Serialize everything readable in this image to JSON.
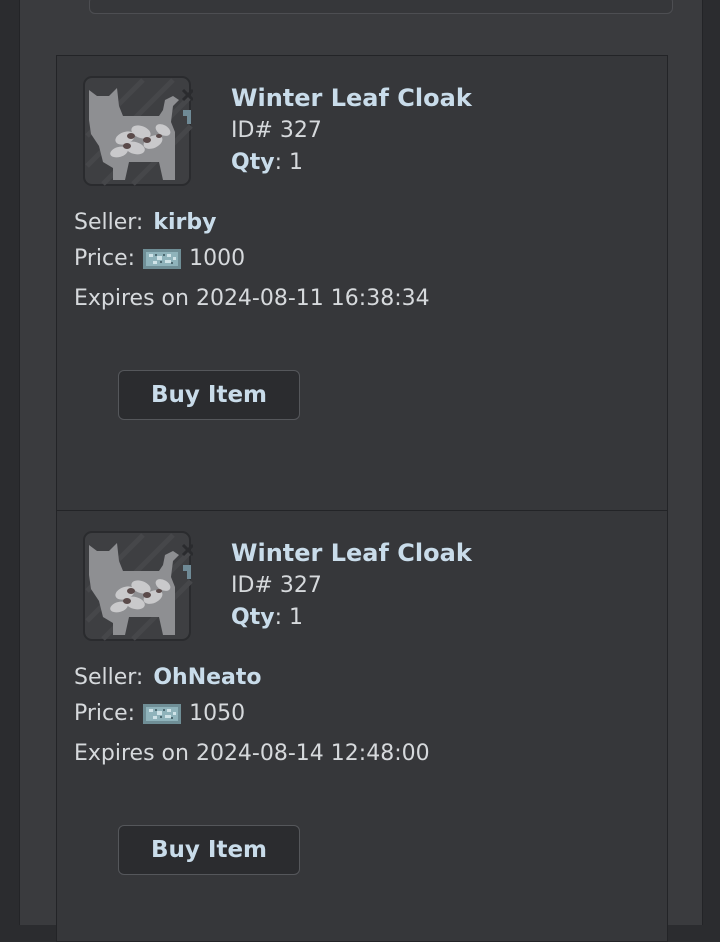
{
  "listings": [
    {
      "item_name": "Winter Leaf Cloak",
      "item_id": "ID# 327",
      "qty_label": "Qty",
      "qty_value": ": 1",
      "seller_label": "Seller:",
      "seller_name": "kirby",
      "price_label": "Price:",
      "price_value": "1000",
      "expires": "Expires on 2024-08-11 16:38:34",
      "buy_label": "Buy Item"
    },
    {
      "item_name": "Winter Leaf Cloak",
      "item_id": "ID# 327",
      "qty_label": "Qty",
      "qty_value": ": 1",
      "seller_label": "Seller:",
      "seller_name": "OhNeato",
      "price_label": "Price:",
      "price_value": "1050",
      "expires": "Expires on 2024-08-14 12:48:00",
      "buy_label": "Buy Item"
    }
  ],
  "icons": {
    "item_thumbnail": "cat-cloak-item-icon",
    "currency": "currency-icon"
  },
  "colors": {
    "accent_text": "#c9dcea",
    "panel_bg": "#3a3b3e",
    "card_bg": "#36373a"
  }
}
